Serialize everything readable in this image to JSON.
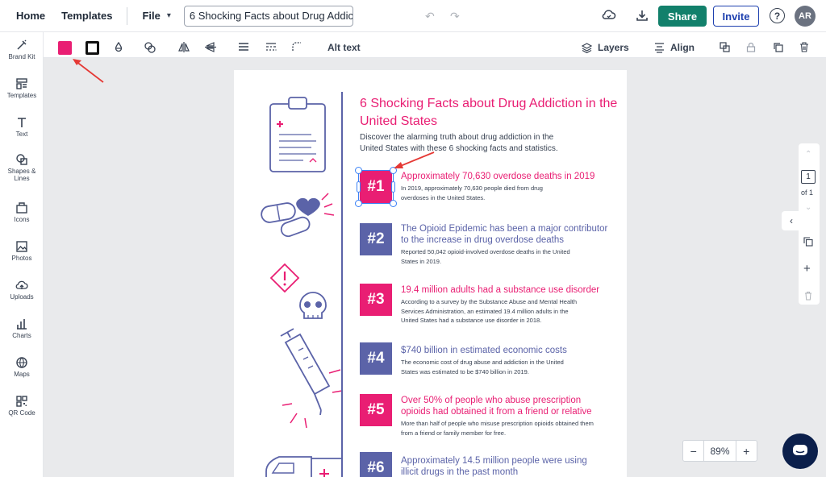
{
  "topbar": {
    "home": "Home",
    "templates": "Templates",
    "file": "File",
    "doc_title": "6 Shocking Facts about Drug Addic",
    "share": "Share",
    "invite": "Invite",
    "help": "?",
    "avatar": "AR"
  },
  "sidebar": {
    "items": [
      {
        "label": "Brand Kit",
        "icon": "brand-kit-icon"
      },
      {
        "label": "Templates",
        "icon": "templates-icon"
      },
      {
        "label": "Text",
        "icon": "text-icon"
      },
      {
        "label": "Shapes & Lines",
        "icon": "shapes-icon"
      },
      {
        "label": "Icons",
        "icon": "icons-icon"
      },
      {
        "label": "Photos",
        "icon": "photos-icon"
      },
      {
        "label": "Uploads",
        "icon": "uploads-icon"
      },
      {
        "label": "Charts",
        "icon": "charts-icon"
      },
      {
        "label": "Maps",
        "icon": "maps-icon"
      },
      {
        "label": "QR Code",
        "icon": "qr-code-icon"
      }
    ]
  },
  "toolbar": {
    "fill_color": "#e91e73",
    "alt_text": "Alt text",
    "layers": "Layers",
    "align": "Align"
  },
  "infographic": {
    "title": "6 Shocking Facts about Drug Addiction in the United States",
    "subtitle": "Discover the alarming truth about drug addiction in the United States with these 6 shocking facts and statistics.",
    "facts": [
      {
        "badge": "#1",
        "heading": "Approximately 70,630 overdose deaths in 2019",
        "body": "In 2019, approximately 70,630 people died from drug overdoses in the United States."
      },
      {
        "badge": "#2",
        "heading": "The Opioid Epidemic has been a major contributor to the increase in drug overdose deaths",
        "body": "Reported 50,042 opioid-involved overdose deaths in the United States in 2019."
      },
      {
        "badge": "#3",
        "heading": "19.4 million adults had a substance use disorder",
        "body": "According to a survey by the Substance Abuse and Mental Health Services Administration, an estimated 19.4 million adults in the United States had a substance use disorder in 2018."
      },
      {
        "badge": "#4",
        "heading": "$740 billion in estimated economic costs",
        "body": "The economic cost of drug abuse and addiction in the United States was estimated to be $740 billion in 2019."
      },
      {
        "badge": "#5",
        "heading": "Over 50% of people who abuse prescription opioids had obtained it from a friend or relative",
        "body": "More than half of people who misuse prescription opioids obtained them from a friend or family member for free."
      },
      {
        "badge": "#6",
        "heading": "Approximately 14.5 million people were using illicit drugs in the past month",
        "body": ""
      }
    ]
  },
  "pages": {
    "current": "1",
    "of": "of 1"
  },
  "zoom": {
    "minus": "−",
    "value": "89%",
    "plus": "+"
  }
}
